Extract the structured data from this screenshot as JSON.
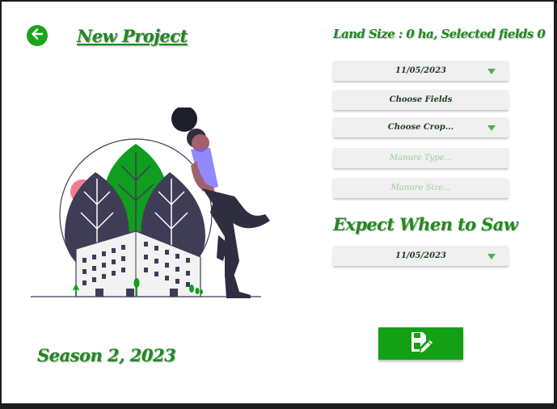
{
  "header": {
    "title": "New Project",
    "back_icon": "arrow-left-circle-icon"
  },
  "footer": {
    "season_label": "Season 2, 2023"
  },
  "form": {
    "land_info": "Land Size : 0 ha, Selected fields 0",
    "date_select": {
      "value": "11/05/2023"
    },
    "choose_fields": {
      "label": "Choose Fields"
    },
    "crop_select": {
      "value": "Choose Crop..."
    },
    "manure_type": {
      "placeholder": "Manure Type..."
    },
    "manure_size": {
      "placeholder": "Manure Size..."
    },
    "expect_heading": "Expect When to Saw",
    "saw_date_select": {
      "value": "11/05/2023"
    },
    "save_button": {
      "icon": "save-edit-icon"
    }
  },
  "colors": {
    "accent": "#1aa51a",
    "heading_green": "#1f8a1f",
    "field_bg": "#f0f0f0",
    "placeholder": "#9ccc9c"
  },
  "illustration": {
    "name": "woman-leaning-on-building-illustration"
  }
}
